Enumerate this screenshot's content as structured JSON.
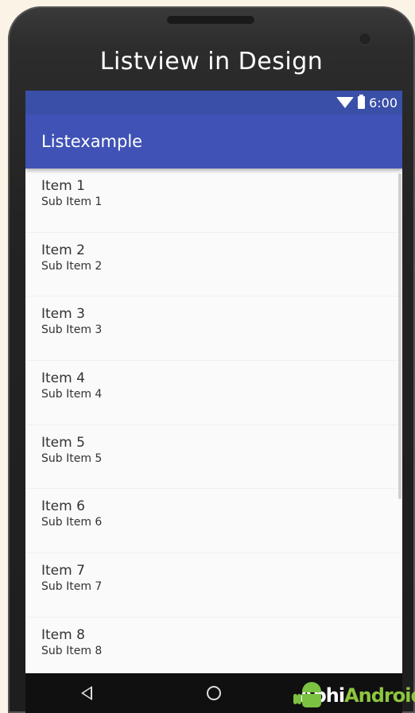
{
  "page": {
    "heading": "Listview in Design"
  },
  "status_bar": {
    "time": "6:00",
    "icons": [
      "wifi-icon",
      "battery-icon"
    ]
  },
  "app_bar": {
    "title": "Listexample",
    "color": "#4052b5"
  },
  "list": {
    "items": [
      {
        "title": "Item 1",
        "subtitle": "Sub Item 1"
      },
      {
        "title": "Item 2",
        "subtitle": "Sub Item 2"
      },
      {
        "title": "Item 3",
        "subtitle": "Sub Item 3"
      },
      {
        "title": "Item 4",
        "subtitle": "Sub Item 4"
      },
      {
        "title": "Item 5",
        "subtitle": "Sub Item 5"
      },
      {
        "title": "Item 6",
        "subtitle": "Sub Item 6"
      },
      {
        "title": "Item 7",
        "subtitle": "Sub Item 7"
      },
      {
        "title": "Item 8",
        "subtitle": "Sub Item 8"
      }
    ]
  },
  "nav_bar": {
    "buttons": [
      "back-icon",
      "home-icon"
    ]
  },
  "watermark": {
    "part1": "Abhi",
    "part2": "Android"
  }
}
